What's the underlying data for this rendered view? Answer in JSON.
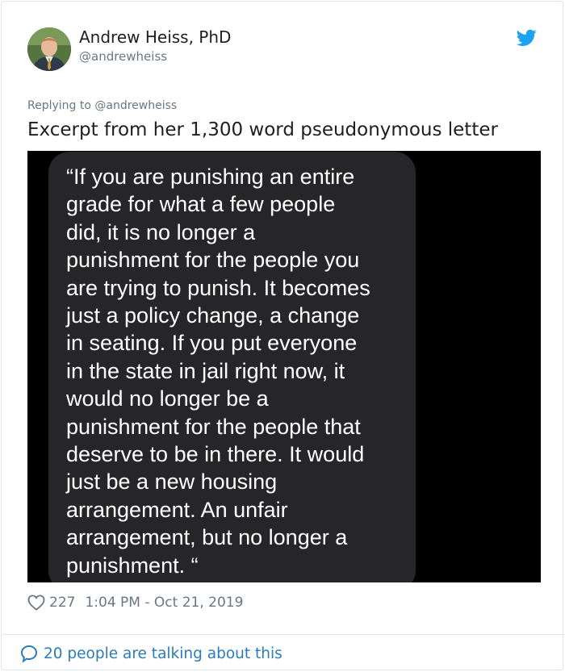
{
  "author": {
    "name": "Andrew Heiss, PhD",
    "handle": "@andrewheiss",
    "avatar_icon": "user-avatar"
  },
  "brand": {
    "icon": "twitter-bird-icon",
    "color": "#1da1f2"
  },
  "tweet": {
    "reply_to": "Replying to @andrewheiss",
    "text": "Excerpt from her 1,300 word pseudonymous letter",
    "image_text_lines": [
      "“If you are punishing an entire",
      "grade for what a few people",
      "did, it is no longer a",
      "punishment for the people you",
      "are trying to punish. It becomes",
      "just a policy change, a change",
      "in seating. If you put everyone",
      "in the state in jail right now, it",
      "would no longer be a",
      "punishment for the people that",
      "deserve to be in there. It would",
      "just be a new housing",
      "arrangement. An unfair",
      "arrangement, but no longer a",
      "punishment. “"
    ]
  },
  "stats": {
    "likes": "227",
    "timestamp": "1:04 PM - Oct 21, 2019",
    "like_icon": "heart-icon"
  },
  "footer": {
    "talking": "20 people are talking about this",
    "icon": "speech-bubble-icon",
    "link_color": "#2b7bb9"
  }
}
